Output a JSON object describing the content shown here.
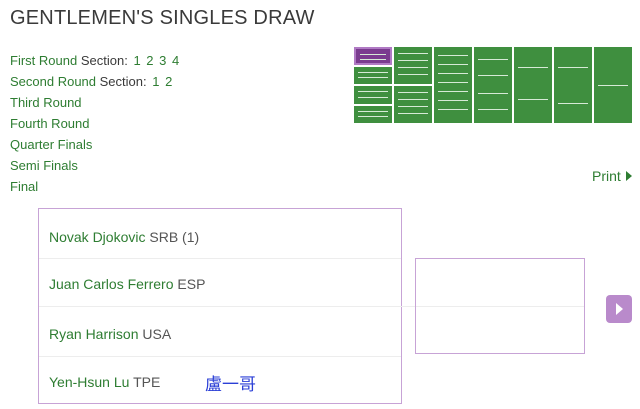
{
  "title": "GENTLEMEN'S SINGLES DRAW",
  "rounds": {
    "first": {
      "label": "First Round",
      "section_label": "Section:",
      "sections": [
        "1",
        "2",
        "3",
        "4"
      ]
    },
    "second": {
      "label": "Second Round",
      "section_label": "Section:",
      "sections": [
        "1",
        "2"
      ]
    },
    "third": "Third Round",
    "fourth": "Fourth Round",
    "quarter": "Quarter Finals",
    "semi": "Semi Finals",
    "final": "Final"
  },
  "print_label": "Print",
  "players": [
    {
      "name": "Novak Djokovic",
      "info": "SRB (1)"
    },
    {
      "name": "Juan Carlos Ferrero",
      "info": "ESP"
    },
    {
      "name": "Ryan Harrison",
      "info": "USA"
    },
    {
      "name": "Yen-Hsun Lu",
      "info": "TPE"
    }
  ],
  "annotation": "盧一哥",
  "colors": {
    "green": "#2e7d32",
    "tile_green": "#3f8f3f",
    "purple": "#b98acb",
    "selected_tile": "#7a3b8f"
  }
}
